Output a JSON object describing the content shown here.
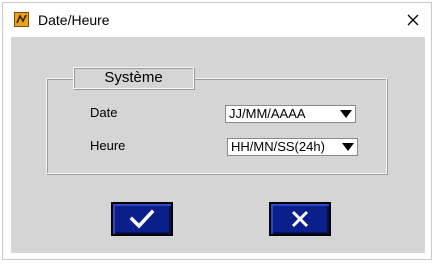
{
  "window": {
    "title": "Date/Heure"
  },
  "group": {
    "title": "Système"
  },
  "fields": {
    "date_label": "Date",
    "date_value": "JJ/MM/AAAA",
    "time_label": "Heure",
    "time_value": "HH/MN/SS(24h)"
  },
  "icons": {
    "app": "app-icon",
    "close": "close-icon",
    "ok": "checkmark-icon",
    "cancel": "x-icon",
    "dropdown": "dropdown-arrow-icon"
  },
  "colors": {
    "button_fill": "#0b1f8a",
    "client_bg": "#d5d5d5",
    "icon_orange": "#e8a21c"
  }
}
